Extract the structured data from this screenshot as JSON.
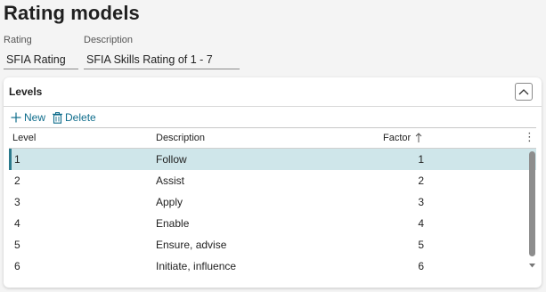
{
  "page": {
    "title": "Rating models"
  },
  "header_fields": {
    "rating": {
      "label": "Rating",
      "value": "SFIA Rating"
    },
    "description": {
      "label": "Description",
      "value": "SFIA Skills Rating of 1 - 7"
    }
  },
  "levels": {
    "title": "Levels",
    "toolbar": {
      "new_label": "New",
      "delete_label": "Delete"
    },
    "columns": {
      "level": "Level",
      "description": "Description",
      "factor": "Factor"
    },
    "rows": [
      {
        "level": "1",
        "description": "Follow",
        "factor": "1"
      },
      {
        "level": "2",
        "description": "Assist",
        "factor": "2"
      },
      {
        "level": "3",
        "description": "Apply",
        "factor": "3"
      },
      {
        "level": "4",
        "description": "Enable",
        "factor": "4"
      },
      {
        "level": "5",
        "description": "Ensure, advise",
        "factor": "5"
      },
      {
        "level": "6",
        "description": "Initiate, influence",
        "factor": "6"
      }
    ]
  },
  "colors": {
    "accent": "#0f6d8c",
    "selected_row": "#cfe6ea"
  },
  "icons": {
    "new": "plus-icon",
    "delete": "trash-icon",
    "collapse": "chevron-up-icon",
    "sort": "arrow-up-icon",
    "more": "more-vertical-icon"
  }
}
